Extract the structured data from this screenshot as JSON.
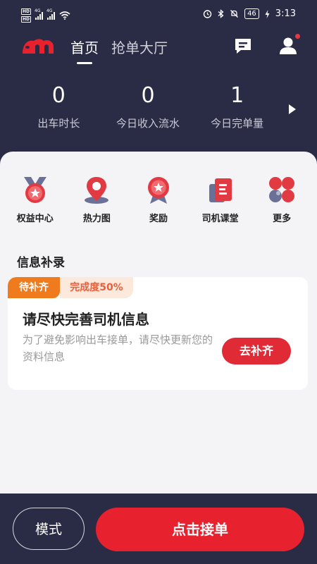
{
  "status_bar": {
    "hd_top": "HD",
    "hd_bottom": "HD",
    "net1": "4G",
    "net2": "4G",
    "battery": "46",
    "time": "3:13"
  },
  "header": {
    "tabs": [
      {
        "label": "首页",
        "active": true
      },
      {
        "label": "抢单大厅",
        "active": false
      }
    ],
    "icons": [
      "message-icon",
      "profile-icon"
    ]
  },
  "stats": [
    {
      "value": "0",
      "label": "出车时长"
    },
    {
      "value": "0",
      "label": "今日收入流水"
    },
    {
      "value": "1",
      "label": "今日完单量"
    }
  ],
  "quick_actions": [
    {
      "label": "权益中心",
      "icon": "rights-center-icon"
    },
    {
      "label": "热力图",
      "icon": "heatmap-icon"
    },
    {
      "label": "奖励",
      "icon": "reward-icon"
    },
    {
      "label": "司机课堂",
      "icon": "driver-classroom-icon"
    },
    {
      "label": "更多",
      "icon": "more-icon"
    }
  ],
  "info_section": {
    "title": "信息补录",
    "card": {
      "tag": "待补齐",
      "progress": "完成度50%",
      "title": "请尽快完善司机信息",
      "description": "为了避免影响出车接单，请尽快更新您的资料信息",
      "button": "去补齐"
    }
  },
  "bottom_bar": {
    "mode_label": "模式",
    "accept_label": "点击接单"
  },
  "colors": {
    "dark_bg": "#2a2b45",
    "accent_red": "#e8212f",
    "orange": "#f07a1e"
  }
}
